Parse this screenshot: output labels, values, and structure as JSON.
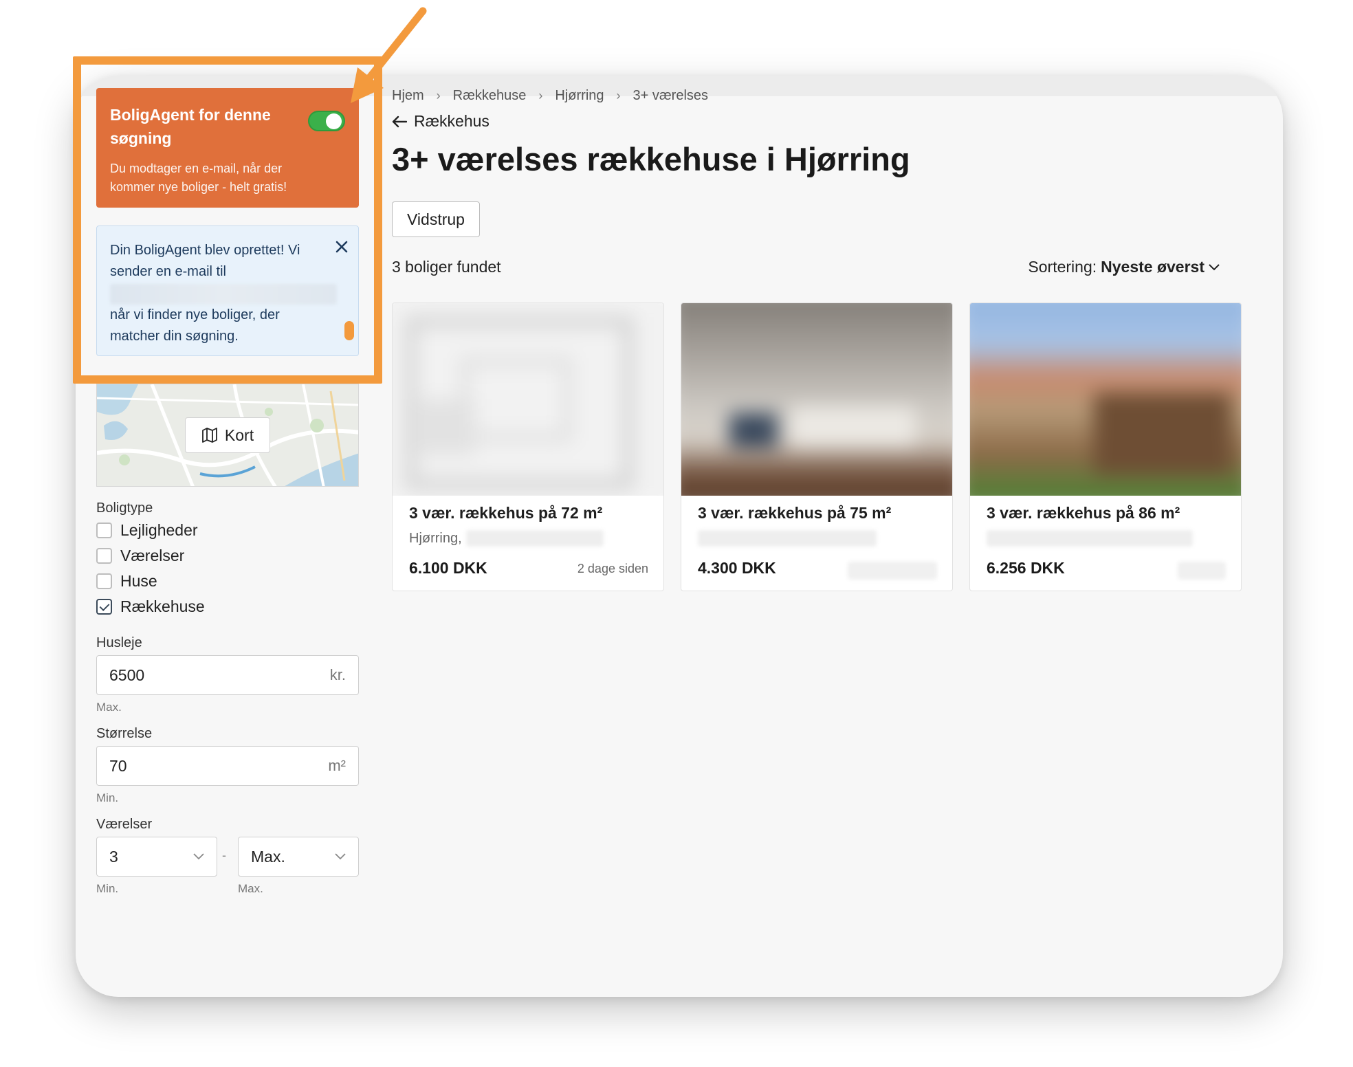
{
  "sidebar": {
    "agent": {
      "title": "BoligAgent for denne søgning",
      "description": "Du modtager en e-mail, når der kommer nye boliger - helt gratis!",
      "toggle_on": true
    },
    "notice": {
      "line1": "Din BoligAgent blev oprettet! Vi sender en e-mail til",
      "line2": "når vi finder nye boliger, der matcher din søgning."
    },
    "map": {
      "button_label": "Kort"
    },
    "boligtype": {
      "label": "Boligtype",
      "options": [
        {
          "label": "Lejligheder",
          "checked": false
        },
        {
          "label": "Værelser",
          "checked": false
        },
        {
          "label": "Huse",
          "checked": false
        },
        {
          "label": "Rækkehuse",
          "checked": true
        }
      ]
    },
    "husleje": {
      "label": "Husleje",
      "value": "6500",
      "unit": "kr.",
      "hint": "Max."
    },
    "stoerrelse": {
      "label": "Størrelse",
      "value": "70",
      "unit": "m²",
      "hint": "Min."
    },
    "vaerelser": {
      "label": "Værelser",
      "min_value": "3",
      "max_value": "Max.",
      "min_hint": "Min.",
      "max_hint": "Max.",
      "separator": "-"
    }
  },
  "main": {
    "breadcrumb": [
      "Hjem",
      "Rækkehuse",
      "Hjørring",
      "3+ værelses"
    ],
    "back_label": "Rækkehus",
    "title": "3+ værelses rækkehuse i Hjørring",
    "chip": "Vidstrup",
    "count": "3 boliger fundet",
    "sort_label": "Sortering:",
    "sort_value": "Nyeste øverst",
    "listings": [
      {
        "title": "3 vær. rækkehus på 72 m²",
        "address": "Hjørring,",
        "price": "6.100 DKK",
        "age": "2 dage siden"
      },
      {
        "title": "3 vær. rækkehus på 75 m²",
        "address": "",
        "price": "4.300 DKK",
        "age": ""
      },
      {
        "title": "3 vær. rækkehus på 86 m²",
        "address": "",
        "price": "6.256 DKK",
        "age": ""
      }
    ]
  },
  "colors": {
    "agent_bg": "#e0703b",
    "toggle_on": "#3bb04a",
    "notice_bg": "#e8f2fb",
    "annotation": "#f39a3d"
  }
}
